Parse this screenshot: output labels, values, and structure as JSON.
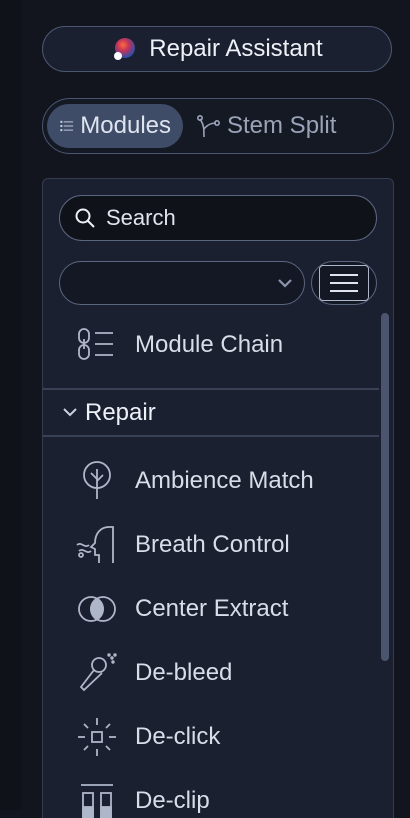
{
  "header": {
    "assistant_label": "Repair Assistant",
    "assistant_icon": "orb-icon"
  },
  "tabs": [
    {
      "label": "Modules",
      "icon": "list-icon",
      "active": true
    },
    {
      "label": "Stem Split",
      "icon": "branch-icon",
      "active": false
    }
  ],
  "search": {
    "placeholder": "Search",
    "value": ""
  },
  "preset_select": {
    "value": ""
  },
  "module_chain": {
    "label": "Module Chain",
    "icon": "chain-icon"
  },
  "section": {
    "label": "Repair",
    "expanded": true
  },
  "modules": [
    {
      "label": "Ambience Match",
      "icon": "tree-icon"
    },
    {
      "label": "Breath Control",
      "icon": "head-breath-icon"
    },
    {
      "label": "Center Extract",
      "icon": "circles-icon"
    },
    {
      "label": "De-bleed",
      "icon": "microphone-icon"
    },
    {
      "label": "De-click",
      "icon": "click-burst-icon"
    },
    {
      "label": "De-clip",
      "icon": "clip-meter-icon"
    }
  ],
  "colors": {
    "background": "#12151d",
    "panel": "#1b2030",
    "active_tab": "#3f4c68",
    "border": "#4a5670"
  }
}
